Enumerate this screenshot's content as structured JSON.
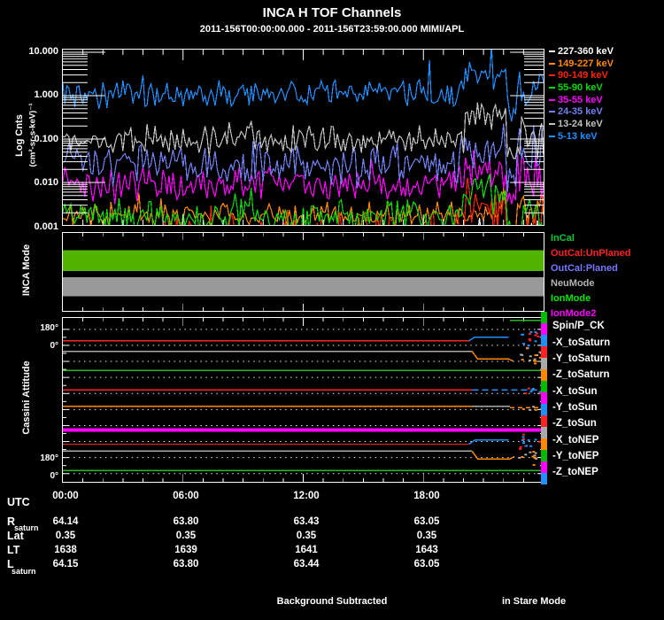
{
  "title": "INCA H TOF Channels",
  "subtitle": "2011-156T00:00:00.000 - 2011-156T23:59:00.000 MIMI/APL",
  "footer": {
    "left": "Background Subtracted",
    "right": "in Stare Mode"
  },
  "top_panel": {
    "ylabel_line1": "Log Cnts",
    "ylabel_line2": "(cm²-sr-s-keV)⁻¹",
    "ytick_labels": [
      "10.000",
      "1.000",
      "0.100",
      "0.010",
      "0.001"
    ],
    "legend": [
      {
        "label": "227-360 keV",
        "color": "#FFFFFF"
      },
      {
        "label": "149-227 keV",
        "color": "#FF8800"
      },
      {
        "label": "90-149 keV",
        "color": "#FF2200"
      },
      {
        "label": "55-90 keV",
        "color": "#00DD00"
      },
      {
        "label": "35-55 keV",
        "color": "#FF00FF"
      },
      {
        "label": "24-35 keV",
        "color": "#7080F0"
      },
      {
        "label": "13-24 keV",
        "color": "#C0C0C0"
      },
      {
        "label": "5-13 keV",
        "color": "#1E90FF"
      }
    ]
  },
  "mode_panel": {
    "label": "INCA Mode",
    "legend": [
      {
        "label": "InCal",
        "color": "#00C832"
      },
      {
        "label": "OutCal:UnPlaned",
        "color": "#FF2222"
      },
      {
        "label": "OutCal:Planed",
        "color": "#7878FF"
      },
      {
        "label": "NeuMode",
        "color": "#B4B4B4"
      },
      {
        "label": "IonMode",
        "color": "#00E800"
      },
      {
        "label": "IonMode2",
        "color": "#FF00FF"
      }
    ]
  },
  "attitude_panel": {
    "label": "Cassini Attitude",
    "ytick_labels": [
      {
        "text": "180°",
        "pct": 0.0695
      },
      {
        "text": "0°",
        "pct": 0.176
      },
      {
        "text": "180°",
        "pct": 0.856
      },
      {
        "text": "0°",
        "pct": 0.963
      }
    ],
    "legend": [
      "Spin/P_CK",
      "-X_toSaturn",
      "-Y_toSaturn",
      "-Z_toSaturn",
      "-X_toSun",
      "-Y_toSun",
      "-Z_toSun",
      "-X_toNEP",
      "-Y_toNEP",
      "-Z_toNEP"
    ],
    "strip_colors": [
      "#00BB00",
      "#FF00FF",
      "#1E90FF",
      "#FF2222",
      "#AAAAAA",
      "#FF8800"
    ]
  },
  "axis_table": {
    "utc_label": "UTC",
    "utc_ticks": [
      "00:00",
      "06:00",
      "12:00",
      "18:00"
    ],
    "rows": [
      {
        "label": "R",
        "sub": "saturn",
        "values": [
          "64.14",
          "63.80",
          "63.43",
          "63.05"
        ]
      },
      {
        "label": "Lat",
        "sub": "",
        "values": [
          "0.35",
          "0.35",
          "0.35",
          "0.35"
        ]
      },
      {
        "label": "LT",
        "sub": "",
        "values": [
          "1638",
          "1639",
          "1641",
          "1643"
        ]
      },
      {
        "label": "L",
        "sub": "saturn",
        "values": [
          "64.15",
          "63.80",
          "63.44",
          "63.05"
        ]
      }
    ]
  },
  "chart_data": [
    {
      "id": "tof_channels",
      "type": "line",
      "title": "INCA H TOF Channels",
      "xlabel": "UTC",
      "x_range_hours": [
        0,
        24
      ],
      "x_ticks": [
        "00:00",
        "06:00",
        "12:00",
        "18:00"
      ],
      "ylabel": "Log Cnts (cm²-sr-s-keV)⁻¹",
      "y_scale": "log",
      "ylim": [
        0.001,
        10.0
      ],
      "y_ticks": [
        10.0,
        1.0,
        0.1,
        0.01,
        0.001
      ],
      "legend_position": "right",
      "grid": false,
      "series": [
        {
          "name": "5-13 keV",
          "color": "#1E90FF",
          "mean_level": 1.1,
          "noise_dex": 0.3,
          "enhancement_mult": 2.6
        },
        {
          "name": "13-24 keV",
          "color": "#C0C0C0",
          "mean_level": 0.1,
          "noise_dex": 0.3,
          "enhancement_mult": 4.0
        },
        {
          "name": "24-35 keV",
          "color": "#7080F0",
          "mean_level": 0.028,
          "noise_dex": 0.4,
          "enhancement_mult": 2.2
        },
        {
          "name": "35-55 keV",
          "color": "#FF00FF",
          "mean_level": 0.009,
          "noise_dex": 0.35,
          "enhancement_mult": 2.0
        },
        {
          "name": "55-90 keV",
          "color": "#00DD00",
          "mean_level": 0.0016,
          "noise_dex": 0.4,
          "enhancement_mult": 3.0
        },
        {
          "name": "90-149 keV",
          "color": "#FF2200",
          "mean_level": 0.0006,
          "noise_dex": 0.5,
          "enhancement_mult": 4.0
        },
        {
          "name": "149-227 keV",
          "color": "#FF8800",
          "mean_level": 0.0018,
          "noise_dex": 0.25,
          "enhancement_mult": 1.2
        },
        {
          "name": "227-360 keV",
          "color": "#FFFFFF",
          "mean_level": 0.0003,
          "noise_dex": 0.4,
          "enhancement_mult": 1.5
        }
      ],
      "events": {
        "enhancement_hours": [
          20.1,
          22.1
        ],
        "dropout_hours": [
          22.15,
          22.65
        ],
        "noisy_tail_hours": [
          22.65,
          24.0
        ]
      }
    },
    {
      "id": "inca_mode",
      "type": "mode-bars",
      "ylabel": "INCA Mode",
      "bars": [
        {
          "color": "#52B300",
          "from_hour": 0.0,
          "to_hour": 24.0,
          "top_pct": 0.222,
          "bottom_pct": 0.489
        },
        {
          "color": "#999999",
          "from_hour": 0.0,
          "to_hour": 24.0,
          "top_pct": 0.567,
          "bottom_pct": 0.811
        }
      ]
    },
    {
      "id": "cassini_attitude",
      "type": "line",
      "ylabel": "Cassini Attitude",
      "y_ticks_deg": [
        180,
        0,
        180,
        0
      ],
      "gridline_pcts": [
        0.0695,
        0.167,
        0.265,
        0.363,
        0.461,
        0.559,
        0.657,
        0.754,
        0.852,
        0.95
      ],
      "solid_lines": [
        {
          "color": "#FF2222",
          "y_pct": 0.139,
          "x0_pct": 0,
          "x1_pct": 0.845,
          "width": 1.5
        },
        {
          "color": "#AAAAAA",
          "y_pct": 0.203,
          "x0_pct": 0,
          "x1_pct": 0.851,
          "width": 1.5
        },
        {
          "color": "#22BB22",
          "y_pct": 0.321,
          "x0_pct": 0,
          "x1_pct": 1.0,
          "width": 1.5
        },
        {
          "color": "#FF2222",
          "y_pct": 0.439,
          "x0_pct": 0,
          "x1_pct": 0.852,
          "width": 1.5
        },
        {
          "color": "#FF8800",
          "y_pct": 0.54,
          "x0_pct": 0,
          "x1_pct": 0.852,
          "width": 1.5
        },
        {
          "color": "#FF00FF",
          "y_pct": 0.684,
          "x0_pct": 0,
          "x1_pct": 1.0,
          "width": 4
        },
        {
          "color": "#FF2222",
          "y_pct": 0.77,
          "x0_pct": 0,
          "x1_pct": 0.845,
          "width": 1.2
        },
        {
          "color": "#AAAAAA",
          "y_pct": 0.813,
          "x0_pct": 0,
          "x1_pct": 0.851,
          "width": 1.5
        },
        {
          "color": "#22BB22",
          "y_pct": 0.93,
          "x0_pct": 0,
          "x1_pct": 1.0,
          "width": 1.5
        },
        {
          "color": "#22BB22",
          "y_pct": 0.016,
          "x0_pct": 0.93,
          "x1_pct": 1.0,
          "width": 1.5
        }
      ],
      "tail_segments": [
        {
          "color": "#1E90FF",
          "width": 1.5,
          "pts": [
            [
              0.845,
              0.139
            ],
            [
              0.856,
              0.118
            ],
            [
              0.927,
              0.118
            ]
          ]
        },
        {
          "color": "#FF8800",
          "width": 1.5,
          "pts": [
            [
              0.851,
              0.203
            ],
            [
              0.863,
              0.25
            ],
            [
              0.927,
              0.25
            ],
            [
              0.936,
              0.262
            ]
          ]
        },
        {
          "color": "#1E90FF",
          "width": 1.5,
          "dash": "7,4",
          "pts": [
            [
              0.852,
              0.439
            ],
            [
              0.995,
              0.439
            ]
          ]
        },
        {
          "color": "#AAAAAA",
          "width": 1.5,
          "pts": [
            [
              0.852,
              0.54
            ],
            [
              0.93,
              0.54
            ]
          ]
        },
        {
          "color": "#FF8800",
          "width": 1.5,
          "dash": "5,4",
          "pts": [
            [
              0.93,
              0.546
            ],
            [
              0.998,
              0.546
            ]
          ]
        },
        {
          "color": "#1E90FF",
          "width": 1.5,
          "pts": [
            [
              0.845,
              0.77
            ],
            [
              0.857,
              0.745
            ],
            [
              0.927,
              0.745
            ]
          ]
        },
        {
          "color": "#FF8800",
          "width": 1.5,
          "pts": [
            [
              0.851,
              0.813
            ],
            [
              0.863,
              0.86
            ],
            [
              0.93,
              0.86
            ],
            [
              0.939,
              0.846
            ]
          ]
        }
      ],
      "scatter_bands": [
        {
          "colors": [
            "#FF2222",
            "#1E90FF"
          ],
          "y_center_pct": 0.13,
          "y_spread_pct": 0.05,
          "x_range_pct": [
            0.945,
            1.0
          ],
          "n": 16
        },
        {
          "colors": [
            "#AAAAAA",
            "#FF8800"
          ],
          "y_center_pct": 0.225,
          "y_spread_pct": 0.05,
          "x_range_pct": [
            0.945,
            1.0
          ],
          "n": 16
        },
        {
          "colors": [
            "#FF2222",
            "#1E90FF"
          ],
          "y_center_pct": 0.44,
          "y_spread_pct": 0.018,
          "x_range_pct": [
            0.955,
            1.0
          ],
          "n": 8
        },
        {
          "colors": [
            "#AAAAAA",
            "#FF8800"
          ],
          "y_center_pct": 0.545,
          "y_spread_pct": 0.018,
          "x_range_pct": [
            0.955,
            1.0
          ],
          "n": 8
        },
        {
          "colors": [
            "#FF2222",
            "#1E90FF"
          ],
          "y_center_pct": 0.75,
          "y_spread_pct": 0.045,
          "x_range_pct": [
            0.945,
            1.0
          ],
          "n": 14
        },
        {
          "colors": [
            "#AAAAAA",
            "#FF8800"
          ],
          "y_center_pct": 0.85,
          "y_spread_pct": 0.045,
          "x_range_pct": [
            0.945,
            1.0
          ],
          "n": 14
        }
      ]
    }
  ]
}
